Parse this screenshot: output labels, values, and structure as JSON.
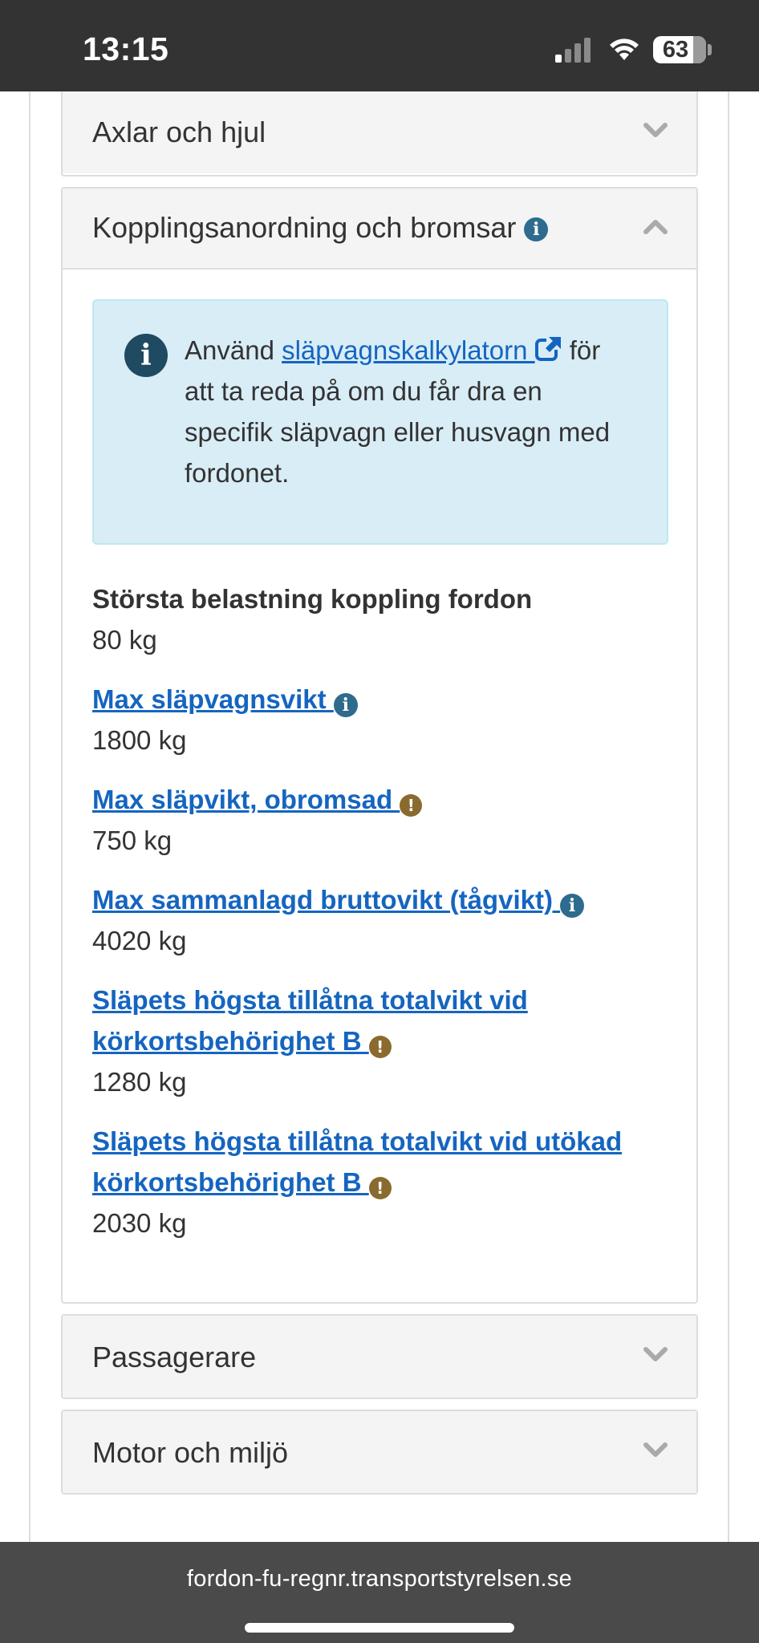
{
  "status_bar": {
    "time": "13:15",
    "battery": "63"
  },
  "accordion": {
    "axlar": {
      "title": "Axlar och hjul",
      "state": "collapsed"
    },
    "koppling": {
      "title": "Kopplingsanordning och bromsar",
      "state": "expanded"
    },
    "passagerare": {
      "title": "Passagerare",
      "state": "collapsed"
    },
    "motor": {
      "title": "Motor och miljö",
      "state": "collapsed"
    }
  },
  "alert": {
    "prefix": "Använd ",
    "link": "släpvagnskalkylatorn ",
    "suffix": " för att ta reda på om du får dra en specifik släpvagn eller husvagn med fordonet."
  },
  "rows": [
    {
      "label": "Största belastning koppling fordon",
      "value": "80 kg"
    },
    {
      "label": "Max släpvagnsvikt ",
      "value": "1800 kg"
    },
    {
      "label": "Max släpvikt, obromsad ",
      "value": "750 kg"
    },
    {
      "label": "Max sammanlagd bruttovikt (tågvikt) ",
      "value": "4020 kg"
    },
    {
      "label": "Släpets högsta tillåtna totalvikt vid körkortsbehörighet B ",
      "value": "1280 kg"
    },
    {
      "label": "Släpets högsta tillåtna totalvikt vid utökad körkortsbehörighet B ",
      "value": "2030 kg"
    }
  ],
  "browser": {
    "url": "fordon-fu-regnr.transportstyrelsen.se"
  },
  "colors": {
    "link": "#1565c0",
    "info_icon": "#2e6b8e",
    "warn_icon": "#8a6a2e",
    "alert_bg": "#d9edf7",
    "panel_head_bg": "#f4f4f4"
  },
  "icons": {
    "info": "info-circle",
    "warning": "exclamation-circle",
    "external_link": "external-link",
    "chevron_down": "chevron-down",
    "chevron_up": "chevron-up"
  }
}
